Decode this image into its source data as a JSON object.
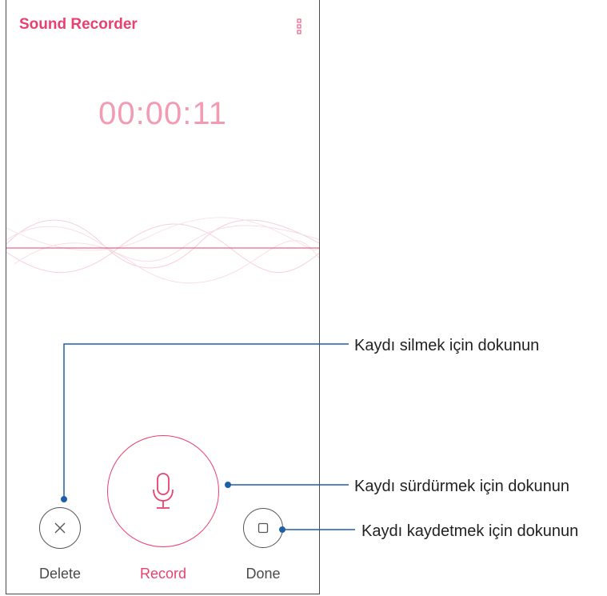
{
  "app": {
    "title": "Sound Recorder"
  },
  "recorder": {
    "elapsed": "00:00:11"
  },
  "controls": {
    "delete_label": "Delete",
    "record_label": "Record",
    "done_label": "Done"
  },
  "callouts": {
    "delete": "Kaydı silmek için dokunun",
    "record": "Kaydı sürdürmek için dokunun",
    "done": "Kaydı kaydetmek için dokunun"
  },
  "icons": {
    "menu": "more-vert-icon",
    "delete": "close-icon",
    "record": "microphone-icon",
    "done": "stop-icon"
  },
  "colors": {
    "accent": "#e8416f",
    "timer": "#f29bb2",
    "callout_line": "#1f5fa8"
  }
}
